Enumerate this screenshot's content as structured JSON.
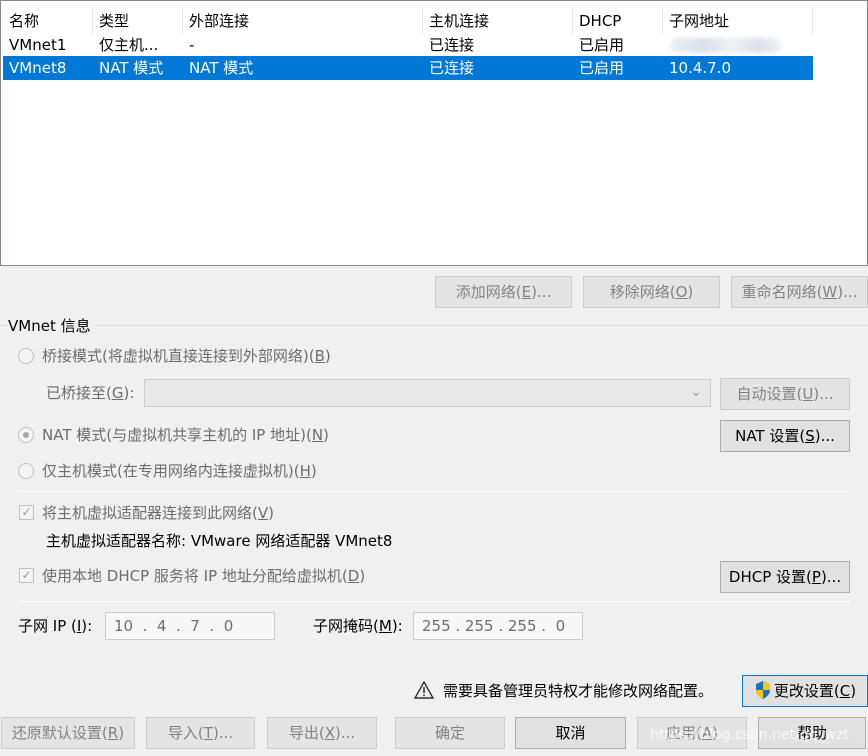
{
  "network_list": {
    "columns": [
      "名称",
      "类型",
      "外部连接",
      "主机连接",
      "DHCP",
      "子网地址"
    ],
    "rows": [
      {
        "name": "VMnet1",
        "type": "仅主机...",
        "external": "-",
        "host": "已连接",
        "dhcp": "已启用",
        "subnet": ""
      },
      {
        "name": "VMnet8",
        "type": "NAT 模式",
        "external": "NAT 模式",
        "host": "已连接",
        "dhcp": "已启用",
        "subnet": "10.4.7.0",
        "selected": true
      }
    ]
  },
  "list_buttons": {
    "add": {
      "text": "添加网络(",
      "key": "E",
      "tail": ")..."
    },
    "remove": {
      "text": "移除网络(",
      "key": "O",
      "tail": ")"
    },
    "rename": {
      "text": "重命名网络(",
      "key": "W",
      "tail": ")..."
    }
  },
  "vmnet_info": {
    "title": "VMnet 信息",
    "bridged": {
      "text": "桥接模式(将虚拟机直接连接到外部网络)(",
      "key": "B",
      "tail": ")",
      "checked": false
    },
    "bridged_to": {
      "text": "已桥接至(",
      "key": "G",
      "tail": "):",
      "value": ""
    },
    "auto_settings": {
      "text": "自动设置(",
      "key": "U",
      "tail": ")..."
    },
    "nat": {
      "text": "NAT 模式(与虚拟机共享主机的 IP 地址)(",
      "key": "N",
      "tail": ")",
      "checked": true
    },
    "nat_settings": {
      "text": "NAT 设置(",
      "key": "S",
      "tail": ")..."
    },
    "host_only": {
      "text": "仅主机模式(在专用网络内连接虚拟机)(",
      "key": "H",
      "tail": ")",
      "checked": false
    },
    "connect_adapter": {
      "text": "将主机虚拟适配器连接到此网络(",
      "key": "V",
      "tail": ")",
      "checked": true
    },
    "adapter_name": "主机虚拟适配器名称: VMware 网络适配器 VMnet8",
    "use_dhcp": {
      "text": "使用本地 DHCP 服务将 IP 地址分配给虚拟机(",
      "key": "D",
      "tail": ")",
      "checked": true
    },
    "dhcp_settings": {
      "text": "DHCP 设置(",
      "key": "P",
      "tail": ")..."
    },
    "subnet_ip": {
      "label": "子网 IP (",
      "key": "I",
      "tail": "):",
      "value": "10  .  4  .  7  .  0"
    },
    "subnet_mask": {
      "label": "子网掩码(",
      "key": "M",
      "tail": "):",
      "value": "255 . 255 . 255 .  0"
    }
  },
  "admin_notice": "需要具备管理员特权才能修改网络配置。",
  "change_settings": {
    "text": "更改设置(",
    "key": "C",
    "tail": ")"
  },
  "bottom_buttons": {
    "restore": {
      "text": "还原默认设置(",
      "key": "R",
      "tail": ")"
    },
    "import": {
      "text": "导入(",
      "key": "T",
      "tail": ")..."
    },
    "export": {
      "text": "导出(",
      "key": "X",
      "tail": ")..."
    },
    "ok": "确定",
    "cancel": "取消",
    "apply": {
      "text": "应用(",
      "key": "A",
      "tail": ")"
    },
    "help": "帮助"
  },
  "watermark": "https://blog.csdn.net/qq_wzt",
  "colors": {
    "selection": "#0078d7",
    "disabled_text": "#838383",
    "shield_blue": "#1f6fc5",
    "shield_yellow": "#f2c811"
  }
}
